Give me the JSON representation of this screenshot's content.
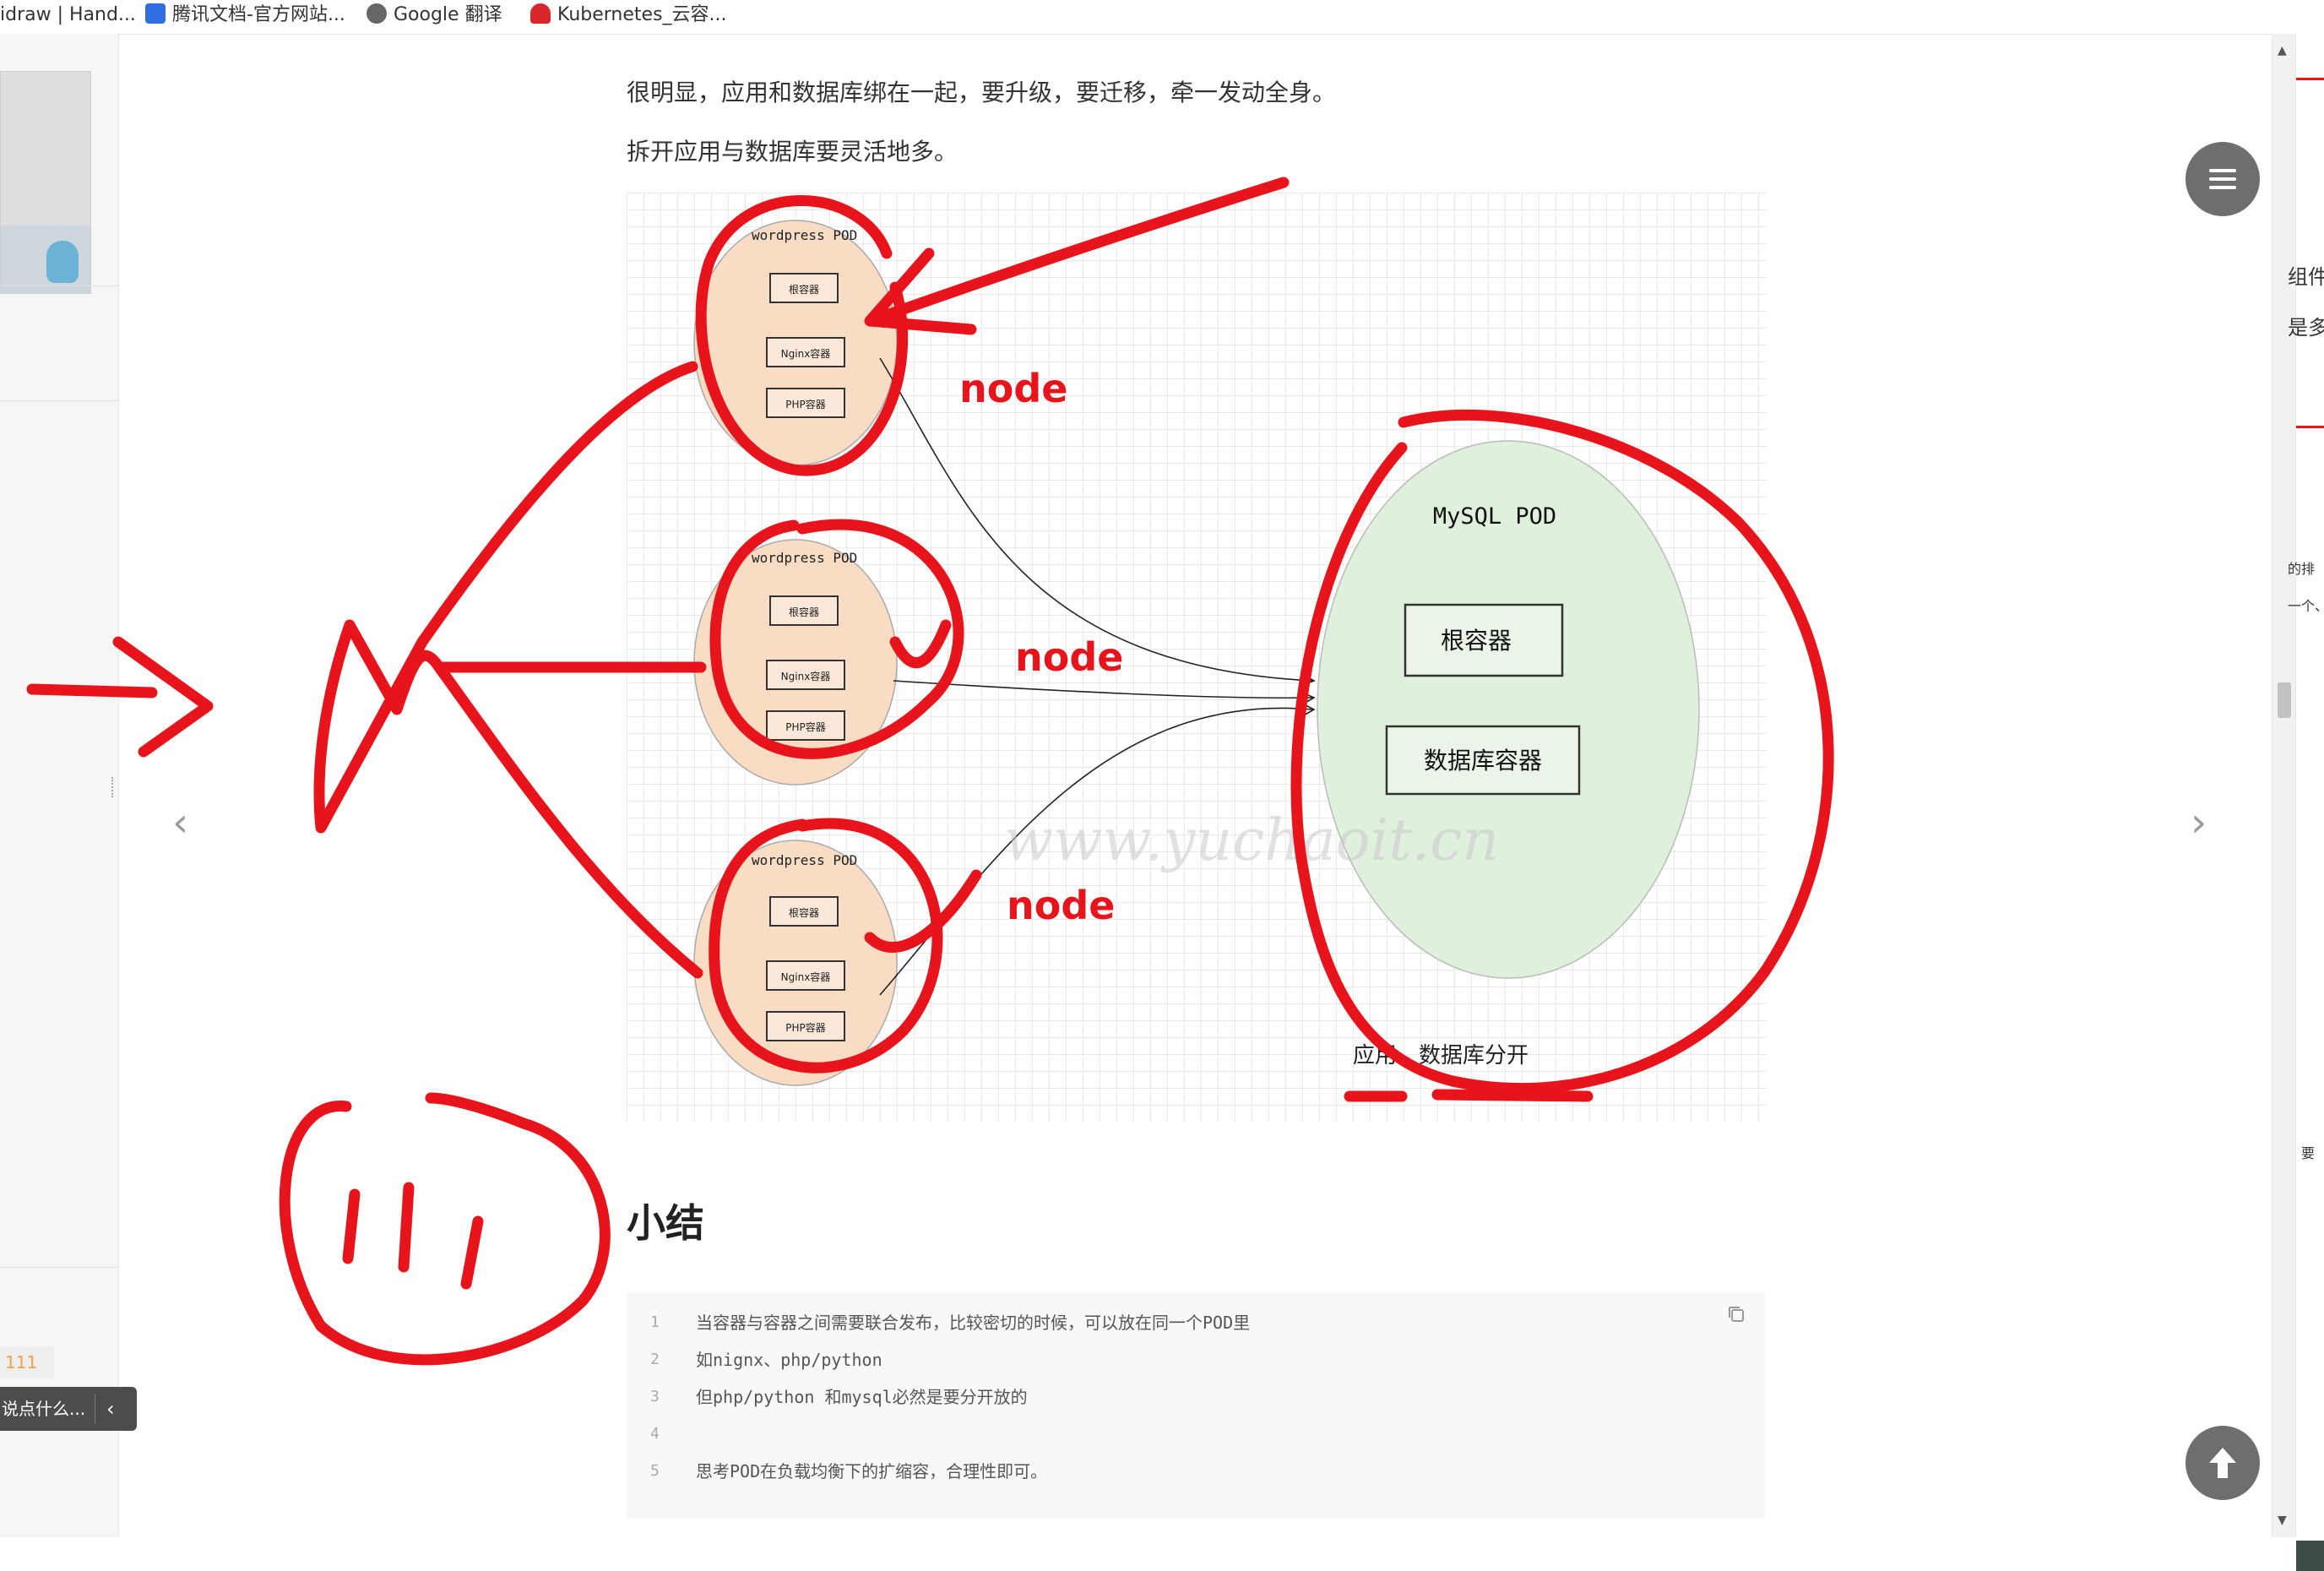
{
  "bookmarks": [
    {
      "label": "idraw | Hand..."
    },
    {
      "label": "腾讯文档-官方网站..."
    },
    {
      "label": "Google 翻译"
    },
    {
      "label": "Kubernetes_云容..."
    }
  ],
  "article": {
    "para1": "很明显，应用和数据库绑在一起，要升级，要迁移，牵一发动全身。",
    "para2": "拆开应用与数据库要灵活地多。",
    "summary_title": "小结",
    "code_lines": [
      {
        "num": "1",
        "text": "当容器与容器之间需要联合发布，比较密切的时候，可以放在同一个POD里"
      },
      {
        "num": "2",
        "text": "如nignx、php/python"
      },
      {
        "num": "3",
        "text": "但php/python 和mysql必然是要分开放的"
      },
      {
        "num": "4",
        "text": ""
      },
      {
        "num": "5",
        "text": "思考POD在负载均衡下的扩缩容，合理性即可。"
      }
    ]
  },
  "figure": {
    "pods": [
      {
        "title": "wordpress POD",
        "root": "根容器",
        "nginx": "Nginx容器",
        "php": "PHP容器"
      },
      {
        "title": "wordpress POD",
        "root": "根容器",
        "nginx": "Nginx容器",
        "php": "PHP容器"
      },
      {
        "title": "wordpress POD",
        "root": "根容器",
        "nginx": "Nginx容器",
        "php": "PHP容器"
      }
    ],
    "mysql": {
      "title": "MySQL POD",
      "root": "根容器",
      "db": "数据库容器"
    },
    "caption": "应用、数据库分开",
    "watermark": "www.yuchaoit.cn"
  },
  "annotations": {
    "node1": "node",
    "node2": "node",
    "node3": "node"
  },
  "sidebar": {
    "like_count": "111",
    "comment_placeholder": "说点什么..."
  },
  "right_strip": {
    "fragments": [
      "组件",
      "是多",
      "的排",
      "一个、",
      "要"
    ]
  },
  "colors": {
    "annotation": "#e8141c",
    "pod_fill": "#f9dcc4",
    "mysql_fill": "#dff0dc",
    "fab": "#6e6e6e"
  }
}
